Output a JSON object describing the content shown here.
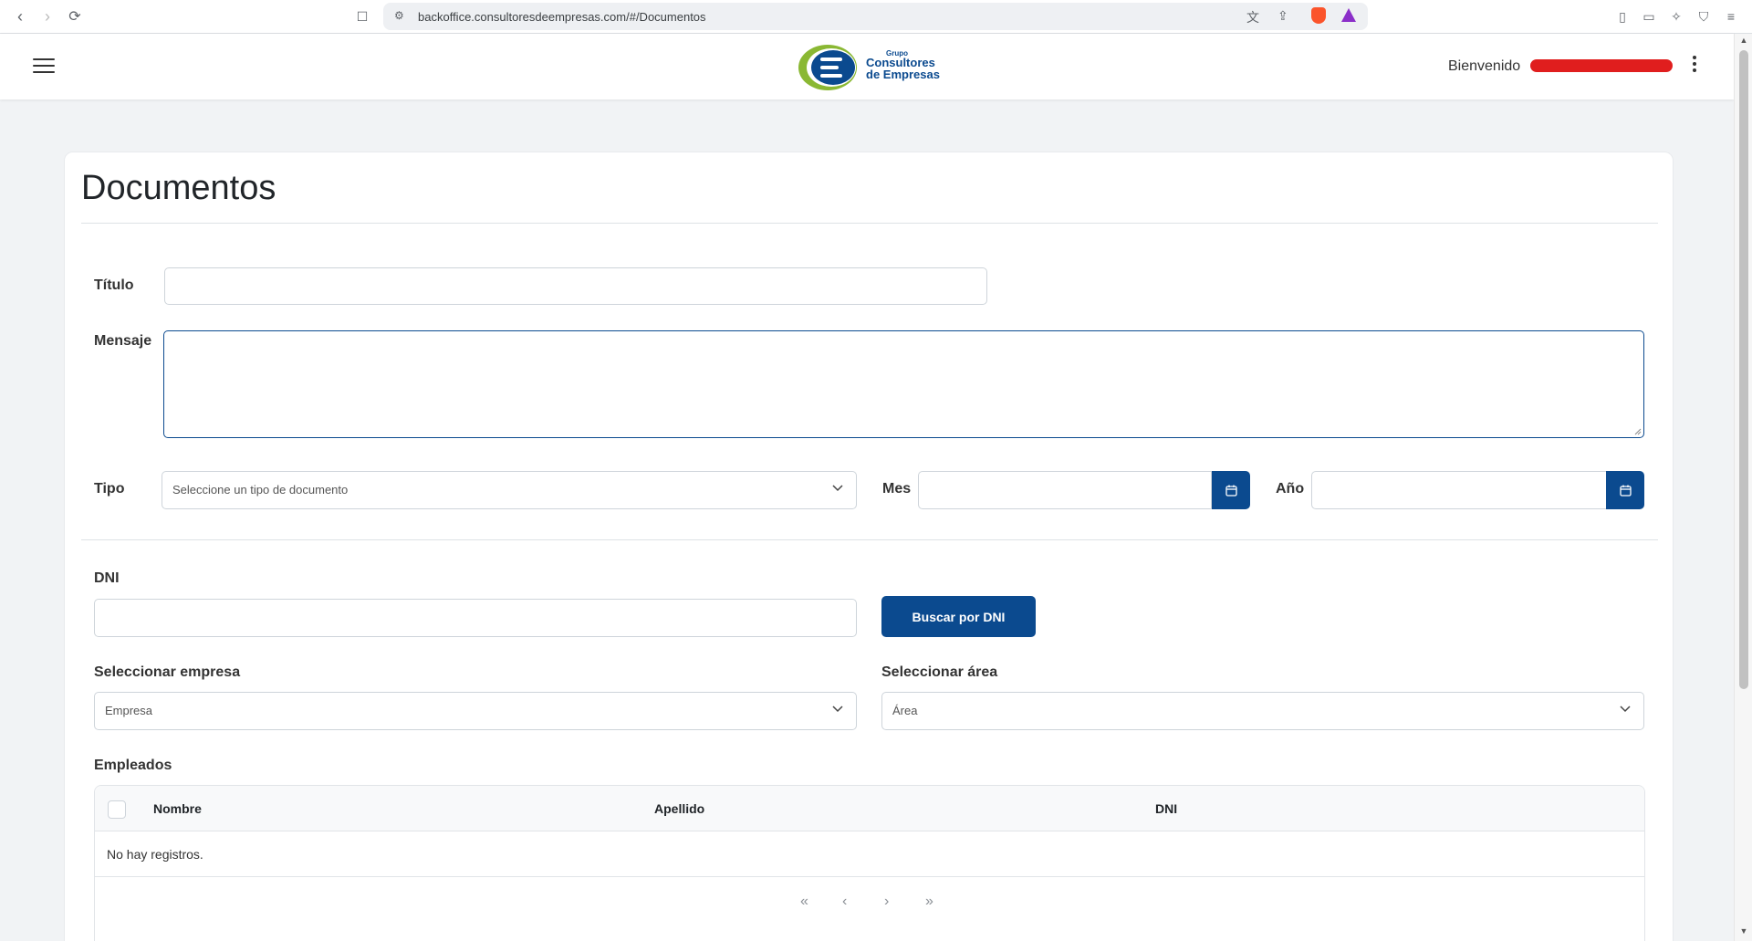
{
  "browser": {
    "url": "backoffice.consultoresdeempresas.com/#/Documentos"
  },
  "header": {
    "logo_small": "Grupo",
    "logo_line1": "Consultores",
    "logo_line2": "de Empresas",
    "welcome": "Bienvenido"
  },
  "page": {
    "title": "Documentos"
  },
  "form": {
    "titulo_label": "Título",
    "mensaje_label": "Mensaje",
    "tipo_label": "Tipo",
    "tipo_placeholder": "Seleccione un tipo de documento",
    "mes_label": "Mes",
    "anio_label": "Año",
    "dni_label": "DNI",
    "buscar_button": "Buscar por DNI",
    "empresa_label": "Seleccionar empresa",
    "empresa_placeholder": "Empresa",
    "area_label": "Seleccionar área",
    "area_placeholder": "Área",
    "empleados_label": "Empleados"
  },
  "table": {
    "columns": [
      "Nombre",
      "Apellido",
      "DNI"
    ],
    "empty_message": "No hay registros."
  },
  "pagination": {
    "first": "«",
    "prev": "‹",
    "next": "›",
    "last": "»"
  },
  "colors": {
    "primary": "#0b4a8f",
    "logo_green": "#8ab833",
    "redaction": "#e01e1e"
  }
}
